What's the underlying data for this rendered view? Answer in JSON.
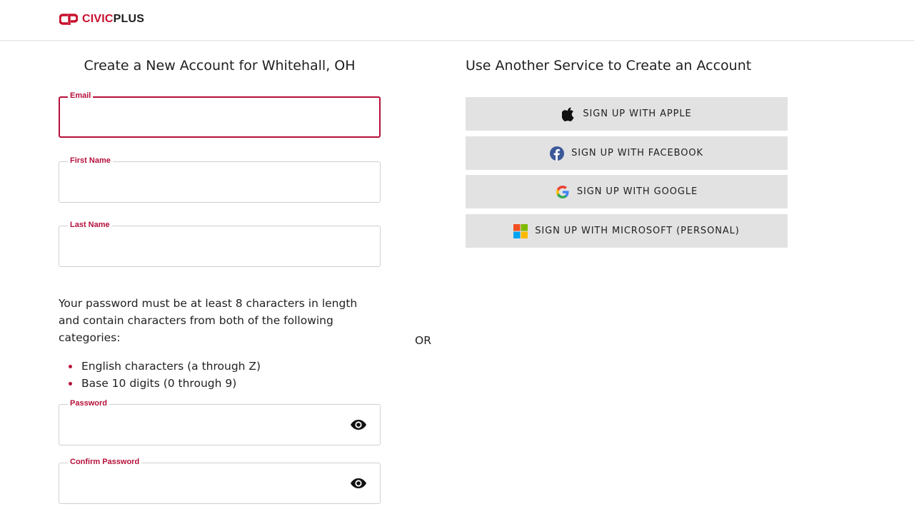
{
  "header": {
    "brand_primary": "CIVIC",
    "brand_secondary": "PLUS"
  },
  "left": {
    "title": "Create a New Account for Whitehall, OH",
    "fields": {
      "email": {
        "label": "Email",
        "value": ""
      },
      "first_name": {
        "label": "First Name",
        "value": ""
      },
      "last_name": {
        "label": "Last Name",
        "value": ""
      },
      "password": {
        "label": "Password",
        "value": ""
      },
      "confirm_password": {
        "label": "Confirm Password",
        "value": ""
      }
    },
    "password_rules": {
      "intro": "Your password must be at least 8 characters in length and contain characters from both of the following categories:",
      "items": [
        "English characters (a through Z)",
        "Base 10 digits (0 through 9)"
      ]
    }
  },
  "divider": {
    "text": "OR"
  },
  "right": {
    "title": "Use Another Service to Create an Account",
    "services": [
      {
        "label": "SIGN UP WITH APPLE",
        "icon": "apple-icon"
      },
      {
        "label": "SIGN UP WITH FACEBOOK",
        "icon": "facebook-icon"
      },
      {
        "label": "SIGN UP WITH GOOGLE",
        "icon": "google-icon"
      },
      {
        "label": "SIGN UP WITH MICROSOFT (PERSONAL)",
        "icon": "microsoft-icon"
      }
    ]
  },
  "colors": {
    "accent": "#b5103a",
    "brand_red": "#c8102e",
    "button_bg": "#e2e2e2",
    "facebook_blue": "#3b5998"
  }
}
